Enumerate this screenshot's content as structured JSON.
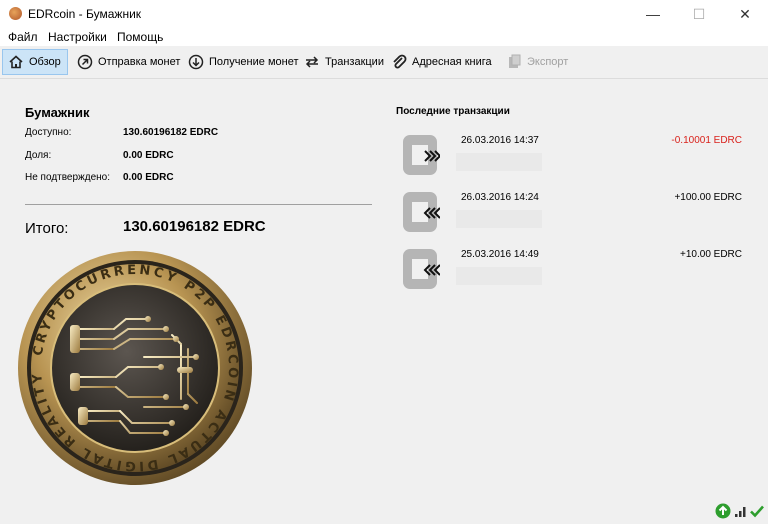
{
  "window": {
    "title": "EDRcoin - Бумажник",
    "minimize": "—",
    "maximize": "☐",
    "close": "✕"
  },
  "menu": [
    "Файл",
    "Настройки",
    "Помощь"
  ],
  "toolbar": {
    "overview": "Обзор",
    "send": "Отправка монет",
    "receive": "Получение монет",
    "transactions": "Транзакции",
    "addressbook": "Адресная книга",
    "export": "Экспорт"
  },
  "wallet": {
    "title": "Бумажник",
    "available_label": "Доступно:",
    "available_value": "130.60196182 EDRC",
    "stake_label": "Доля:",
    "stake_value": "0.00 EDRC",
    "unconfirmed_label": "Не подтверждено:",
    "unconfirmed_value": "0.00 EDRC",
    "total_label": "Итого:",
    "total_value": "130.60196182 EDRC"
  },
  "coin": {
    "top_text": "EDRCOIN",
    "left_text": "P2P",
    "ring_text": "CRYPTOCURRENCY",
    "right_text": "ACTUAL DIGITAL REALITY"
  },
  "recent": {
    "title": "Последние транзакции",
    "items": [
      {
        "date": "26.03.2016 14:37",
        "amount": "-0.10001 EDRC",
        "direction": "out"
      },
      {
        "date": "26.03.2016 14:24",
        "amount": "+100.00 EDRC",
        "direction": "in"
      },
      {
        "date": "25.03.2016 14:49",
        "amount": "+10.00 EDRC",
        "direction": "in"
      }
    ]
  },
  "colors": {
    "accent": "#cce4f7",
    "negative": "#d9221c",
    "status_green": "#2e9e2e"
  }
}
